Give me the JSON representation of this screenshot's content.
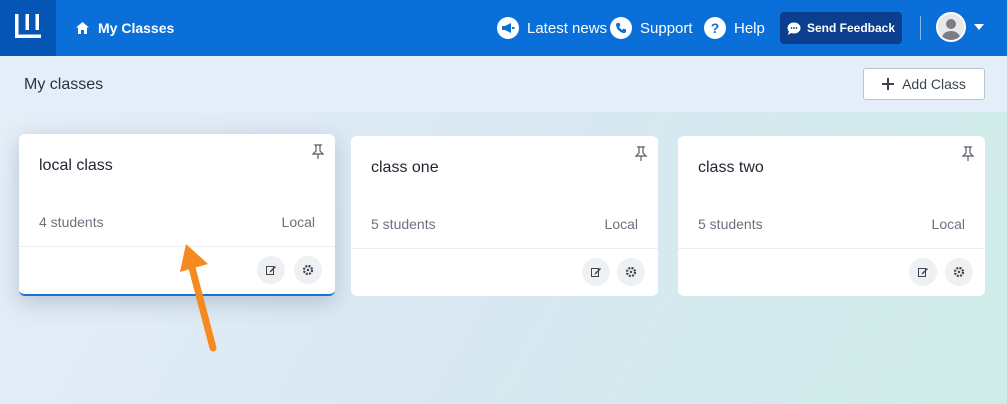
{
  "topbar": {
    "home_label": "My Classes",
    "links": [
      {
        "label": "Latest news",
        "icon": "megaphone-icon"
      },
      {
        "label": "Support",
        "icon": "phone-icon"
      },
      {
        "label": "Help",
        "icon": "question-icon"
      }
    ],
    "feedback_label": "Send Feedback"
  },
  "subheader": {
    "title": "My classes",
    "add_label": "Add Class"
  },
  "classes": [
    {
      "name": "local class",
      "students": "4 students",
      "type": "Local"
    },
    {
      "name": "class one",
      "students": "5 students",
      "type": "Local"
    },
    {
      "name": "class two",
      "students": "5 students",
      "type": "Local"
    }
  ],
  "colors": {
    "topbar": "#0a6fd9",
    "logo_bg": "#0556b4",
    "feedback_bg": "#0b3f8e",
    "arrow": "#f58a1f"
  }
}
